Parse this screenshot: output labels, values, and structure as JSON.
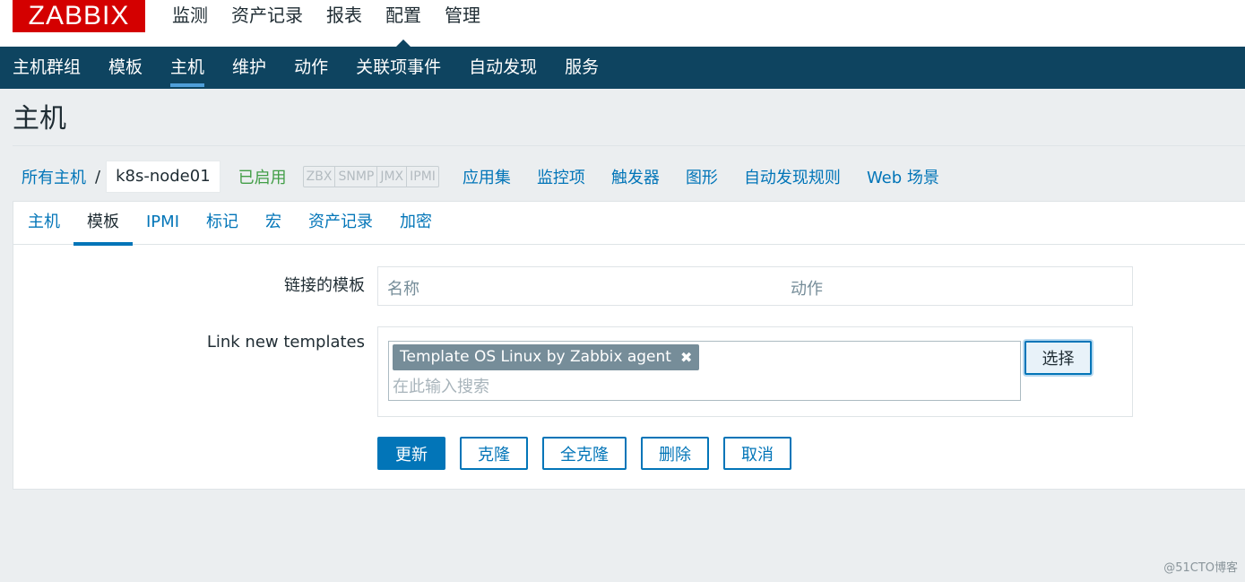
{
  "logo": {
    "text": "ZABBIX",
    "color": "#d40000"
  },
  "main_menu": {
    "items": [
      {
        "label": "监测"
      },
      {
        "label": "资产记录"
      },
      {
        "label": "报表"
      },
      {
        "label": "配置"
      },
      {
        "label": "管理"
      }
    ],
    "active": "配置"
  },
  "sub_menu": {
    "items": [
      {
        "label": "主机群组"
      },
      {
        "label": "模板"
      },
      {
        "label": "主机"
      },
      {
        "label": "维护"
      },
      {
        "label": "动作"
      },
      {
        "label": "关联项事件"
      },
      {
        "label": "自动发现"
      },
      {
        "label": "服务"
      }
    ],
    "active": "主机",
    "background": "#0e4460"
  },
  "page": {
    "title": "主机"
  },
  "breadcrumb": {
    "all_hosts": "所有主机",
    "separator": "/",
    "current_host": "k8s-node01",
    "status": "已启用",
    "availability": [
      "ZBX",
      "SNMP",
      "JMX",
      "IPMI"
    ],
    "links": [
      "应用集",
      "监控项",
      "触发器",
      "图形",
      "自动发现规则",
      "Web 场景"
    ]
  },
  "tabs": {
    "items": [
      {
        "label": "主机"
      },
      {
        "label": "模板"
      },
      {
        "label": "IPMI"
      },
      {
        "label": "标记"
      },
      {
        "label": "宏"
      },
      {
        "label": "资产记录"
      },
      {
        "label": "加密"
      }
    ],
    "active": "模板"
  },
  "form": {
    "linked_templates_label": "链接的模板",
    "linked_table": {
      "col_name": "名称",
      "col_action": "动作"
    },
    "link_new_label": "Link new templates",
    "selected_template": "Template OS Linux by Zabbix agent",
    "remove_icon": "✖",
    "search_placeholder": "在此输入搜索",
    "select_button": "选择"
  },
  "buttons": {
    "update": "更新",
    "clone": "克隆",
    "full_clone": "全克隆",
    "delete": "删除",
    "cancel": "取消"
  },
  "watermark": "@51CTO博客"
}
